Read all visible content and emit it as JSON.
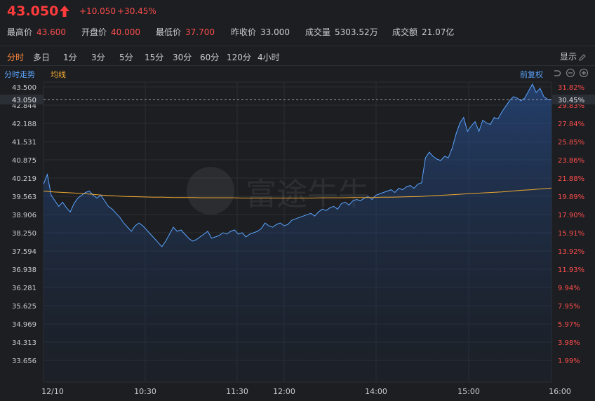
{
  "quote": {
    "price": "43.050",
    "change": "+10.050",
    "change_pct": "+30.45%",
    "stats": [
      {
        "label": "最高价",
        "value": "43.600",
        "color": "red"
      },
      {
        "label": "开盘价",
        "value": "40.000",
        "color": "red"
      },
      {
        "label": "最低价",
        "value": "37.700",
        "color": "red"
      },
      {
        "label": "昨收价",
        "value": "33.000",
        "color": "grey"
      },
      {
        "label": "成交量",
        "value": "5303.52万",
        "color": "grey"
      },
      {
        "label": "成交额",
        "value": "21.07亿",
        "color": "grey"
      }
    ]
  },
  "tabs": [
    "分时",
    "多日",
    "1分",
    "3分",
    "5分",
    "15分",
    "30分",
    "60分",
    "120分",
    "4小时"
  ],
  "active_tab": "分时",
  "toolbar": {
    "display_label": "显示"
  },
  "subbar": {
    "title": "分时走势",
    "avg_label": "均线",
    "adjust_label": "前复权"
  },
  "watermark": "富途牛牛",
  "colors": {
    "up": "#ff4d4d",
    "price_line": "#5ba4ff",
    "avg_line": "#f0a830",
    "accent": "#ff8a3d",
    "background": "#1c1e21"
  },
  "chart_data": {
    "type": "line",
    "title": "",
    "xlabel": "",
    "ylabel": "",
    "x_ticks": [
      "12/10",
      "10:30",
      "11:30",
      "12:00",
      "14:00",
      "15:00",
      "16:00"
    ],
    "y_left_ticks": [
      "43.500",
      "42.844",
      "42.188",
      "41.531",
      "40.875",
      "40.219",
      "39.563",
      "38.906",
      "38.250",
      "37.594",
      "36.938",
      "36.281",
      "35.625",
      "34.969",
      "34.313",
      "33.656"
    ],
    "y_right_ticks": [
      "31.82%",
      "29.83%",
      "27.84%",
      "25.85%",
      "23.86%",
      "21.88%",
      "19.89%",
      "17.90%",
      "15.91%",
      "13.92%",
      "11.93%",
      "9.94%",
      "7.95%",
      "5.97%",
      "3.98%",
      "1.99%"
    ],
    "ylim": [
      33.656,
      43.5
    ],
    "current_price_label": "43.050",
    "current_pct_label": "30.45%",
    "series": [
      {
        "values": [
          40.0,
          40.35,
          39.6,
          39.4,
          39.2,
          39.35,
          39.15,
          39.0,
          39.3,
          39.5,
          39.6,
          39.7,
          39.75,
          39.6,
          39.5,
          39.6,
          39.4,
          39.2,
          39.1,
          38.95,
          38.8,
          38.6,
          38.45,
          38.3,
          38.5,
          38.6,
          38.5,
          38.35,
          38.2,
          38.05,
          37.9,
          37.75,
          37.95,
          38.2,
          38.45,
          38.3,
          38.35,
          38.2,
          38.05,
          37.95,
          38.0,
          38.1,
          38.2,
          38.3,
          38.05,
          38.1,
          38.15,
          38.25,
          38.2,
          38.3,
          38.35,
          38.2,
          38.25,
          38.1,
          38.2,
          38.25,
          38.3,
          38.4,
          38.6,
          38.5,
          38.45,
          38.55,
          38.6,
          38.5,
          38.55,
          38.7,
          38.75,
          38.8,
          38.85,
          38.9,
          38.95,
          38.85,
          39.0,
          39.1,
          39.05,
          39.15,
          39.2,
          39.1,
          39.3,
          39.35,
          39.25,
          39.4,
          39.45,
          39.4,
          39.5,
          39.55,
          39.45,
          39.6,
          39.65,
          39.7,
          39.75,
          39.8,
          39.7,
          39.85,
          39.8,
          39.9,
          39.95,
          39.85,
          40.0,
          40.05,
          40.95,
          41.15,
          41.0,
          40.9,
          40.85,
          41.0,
          40.95,
          41.3,
          41.8,
          42.2,
          42.4,
          41.9,
          42.1,
          42.25,
          41.9,
          42.3,
          42.2,
          42.15,
          42.4,
          42.35,
          42.6,
          42.8,
          43.0,
          43.15,
          43.1,
          43.0,
          43.1,
          43.35,
          43.6,
          43.3,
          43.45,
          43.15,
          43.05,
          43.05
        ],
        "color": "#5ba4ff"
      },
      {
        "values": [
          39.75,
          39.72,
          39.7,
          39.68,
          39.66,
          39.63,
          39.6,
          39.58,
          39.56,
          39.55,
          39.54,
          39.53,
          39.53,
          39.52,
          39.52,
          39.52,
          39.51,
          39.51,
          39.51,
          39.51,
          39.5,
          39.5,
          39.5,
          39.5,
          39.5,
          39.5,
          39.5,
          39.5,
          39.51,
          39.51,
          39.51,
          39.52,
          39.52,
          39.52,
          39.53,
          39.53,
          39.54,
          39.55,
          39.56,
          39.58,
          39.6,
          39.62,
          39.64,
          39.66,
          39.68,
          39.7,
          39.72,
          39.75,
          39.78,
          39.8,
          39.83,
          39.86
        ],
        "color": "#f0a830"
      }
    ]
  }
}
